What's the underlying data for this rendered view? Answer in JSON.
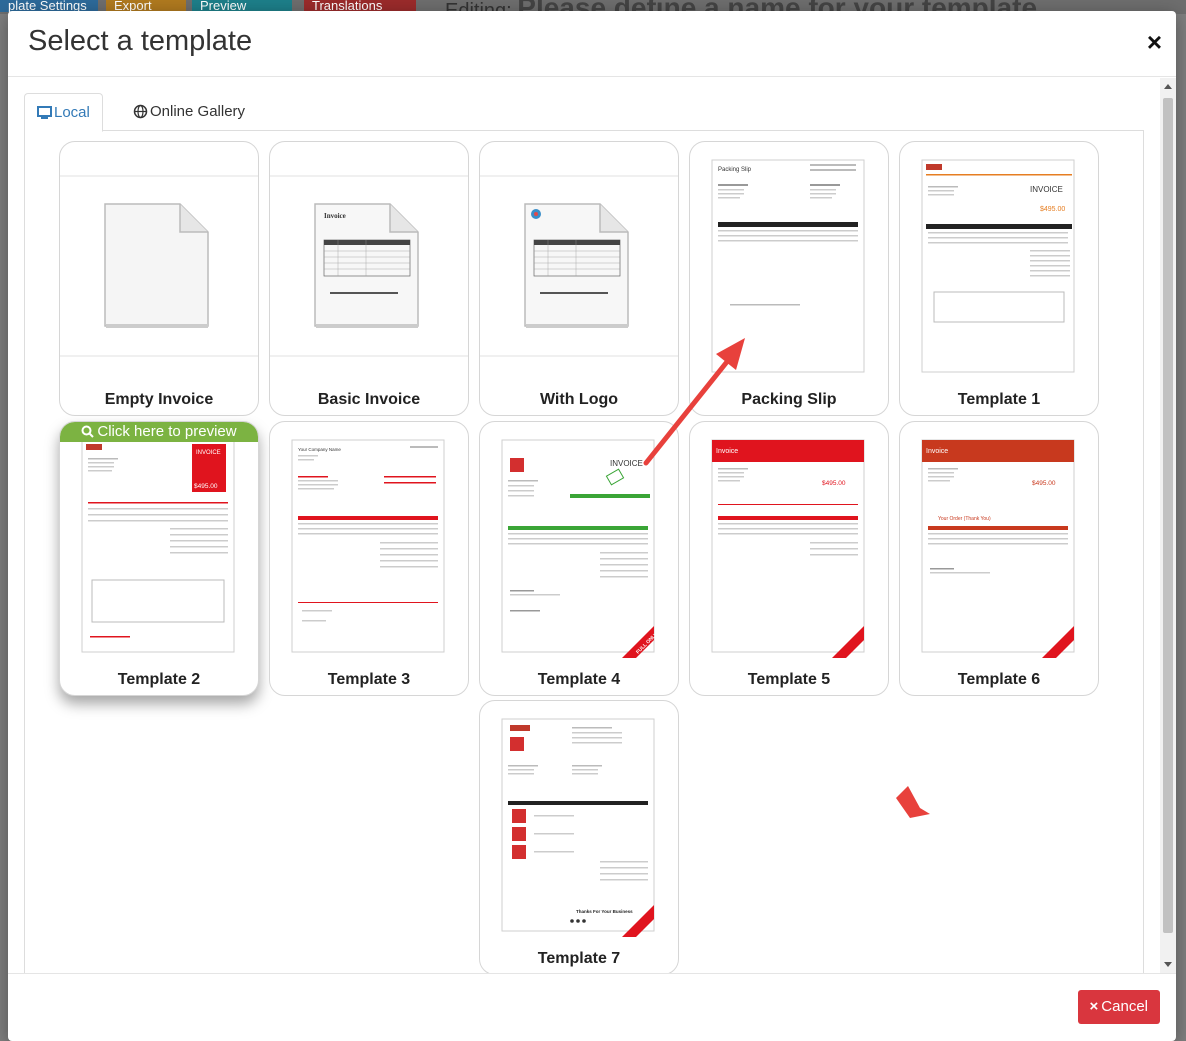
{
  "background": {
    "buttons": [
      "plate Settings",
      "Export",
      "Preview",
      "Translations"
    ],
    "editing_label": "Editing:",
    "editing_title": "Please define a name for your template"
  },
  "modal": {
    "title": "Select a template",
    "close_symbol": "×"
  },
  "tabs": [
    {
      "label": "Local",
      "icon": "monitor-icon",
      "active": true
    },
    {
      "label": "Online Gallery",
      "icon": "globe-icon",
      "active": false
    }
  ],
  "templates": [
    {
      "name": "Empty Invoice",
      "thumb": "blank-document-icon"
    },
    {
      "name": "Basic Invoice",
      "thumb": "document-table-icon",
      "doc_heading": "Invoice"
    },
    {
      "name": "With Logo",
      "thumb": "document-logo-icon"
    },
    {
      "name": "Packing Slip",
      "thumb": "packing-slip-preview",
      "doc_heading": "Packing Slip"
    },
    {
      "name": "Template 1",
      "thumb": "invoice-orange-preview",
      "doc_heading": "INVOICE",
      "amount": "$495.00"
    },
    {
      "name": "Template 2",
      "thumb": "invoice-red-side-preview",
      "doc_heading": "INVOICE",
      "amount": "$495.00"
    },
    {
      "name": "Template 3",
      "thumb": "invoice-plain-preview",
      "doc_heading": "Your Company Name"
    },
    {
      "name": "Template 4",
      "thumb": "invoice-green-preview",
      "doc_heading": "INVOICE"
    },
    {
      "name": "Template 5",
      "thumb": "invoice-red-header-preview",
      "doc_heading": "Invoice",
      "amount": "$495.00"
    },
    {
      "name": "Template 6",
      "thumb": "invoice-darkred-header-preview",
      "doc_heading": "Invoice",
      "amount": "$495.00",
      "extra": "Your Order (Thank You)"
    },
    {
      "name": "Template 7",
      "thumb": "invoice-product-images-preview",
      "doc_heading": "Thanks For Your Business"
    }
  ],
  "hover_preview": "Click here to preview",
  "watermark": "FULL ONLY",
  "footer": {
    "cancel_label": "Cancel",
    "cancel_symbol": "×"
  },
  "colors": {
    "accent_blue": "#337ab7",
    "preview_green": "#7cb342",
    "cancel_red": "#d9363e",
    "annotation_arrow": "#e8413c"
  }
}
